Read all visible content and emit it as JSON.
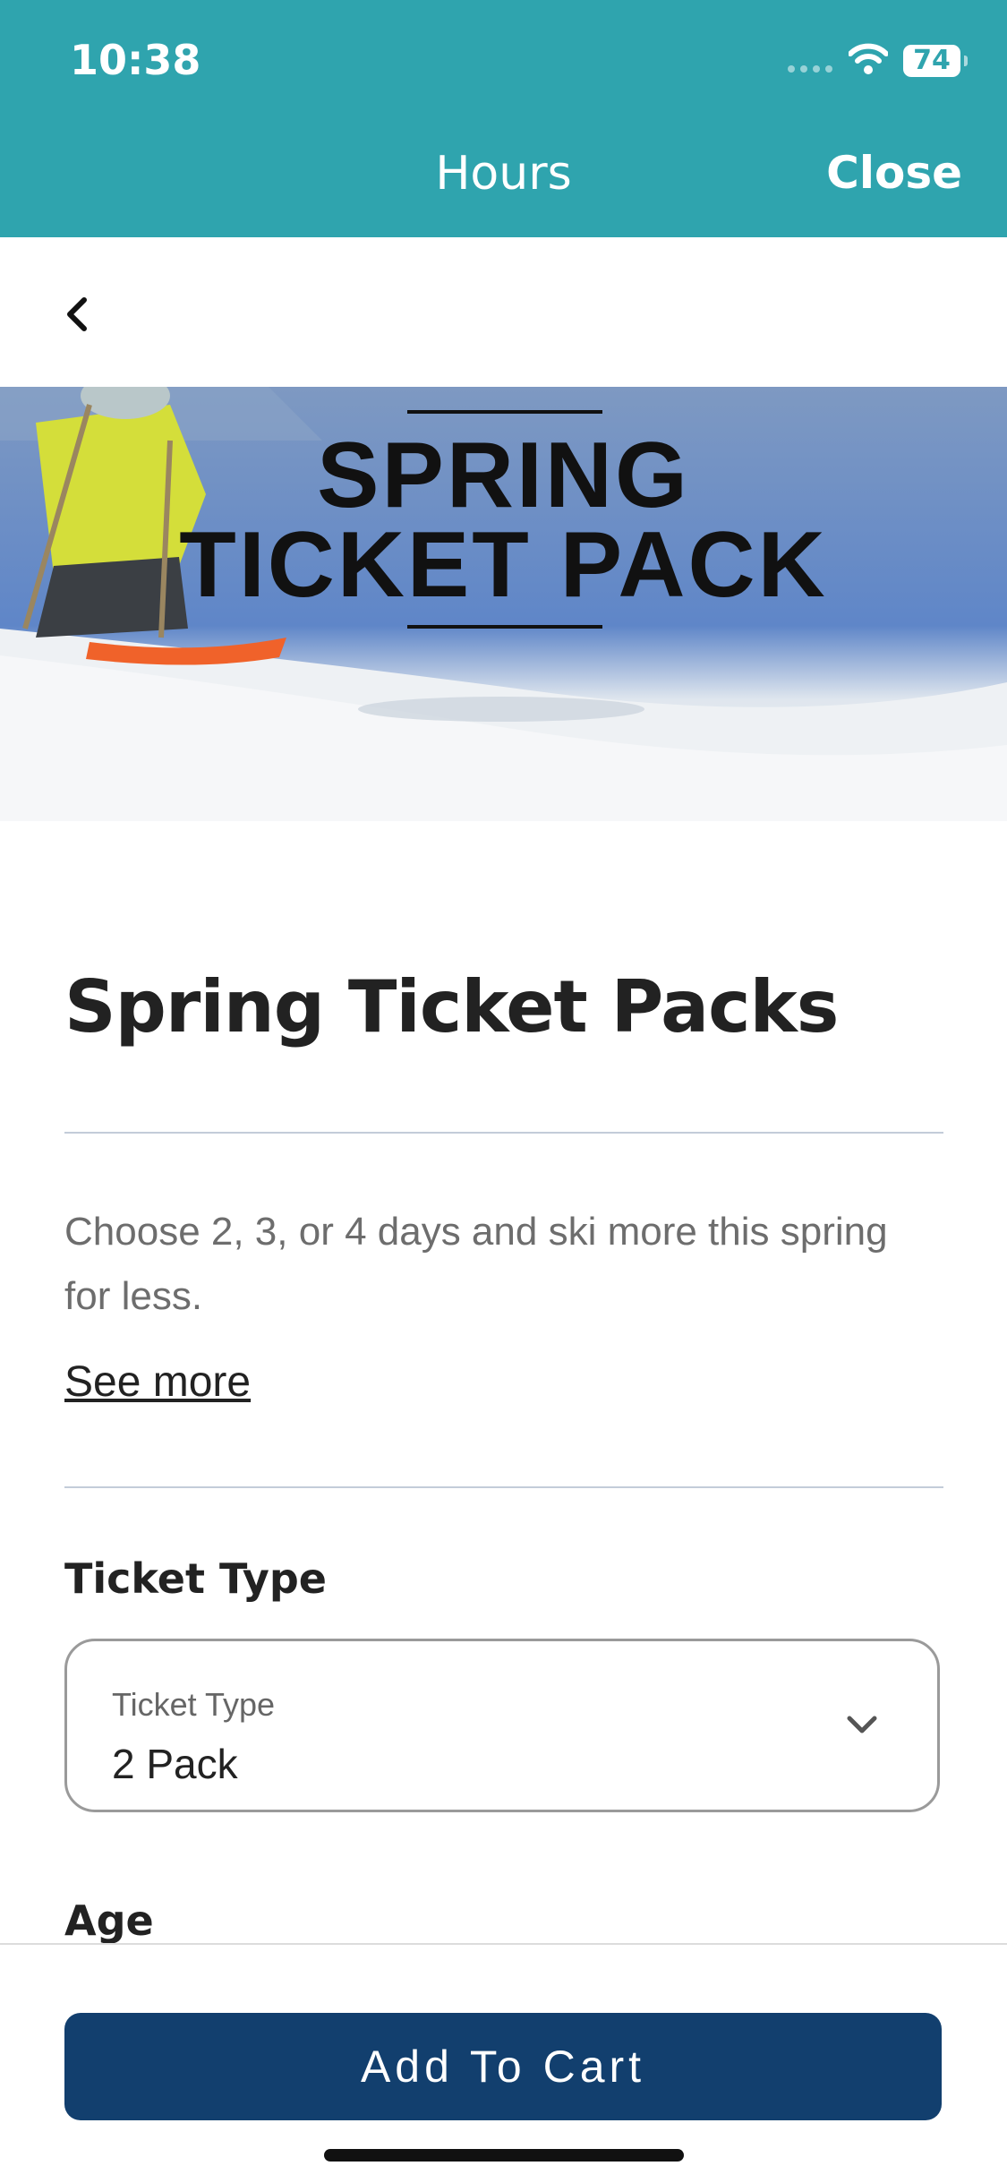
{
  "status_bar": {
    "time": "10:38",
    "battery": "74"
  },
  "nav": {
    "title": "Hours",
    "close_label": "Close"
  },
  "banner": {
    "line1": "SPRING",
    "line2": "TICKET PACK"
  },
  "product": {
    "title": "Spring Ticket Packs",
    "description": "Choose 2, 3, or 4 days and ski more this spring for less.",
    "see_more": "See more"
  },
  "ticket_type": {
    "section_label": "Ticket Type",
    "field_label": "Ticket Type",
    "selected_value": "2 Pack"
  },
  "age": {
    "section_label": "Age"
  },
  "footer": {
    "add_to_cart_label": "Add To Cart"
  },
  "colors": {
    "header_teal": "#2fa4ae",
    "button_navy": "#123f6e"
  }
}
